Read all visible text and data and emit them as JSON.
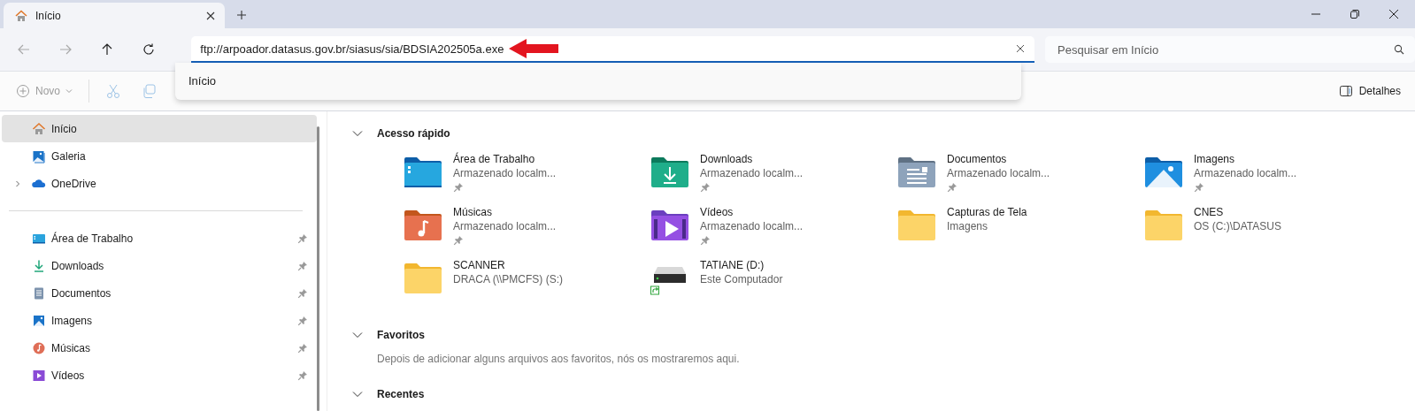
{
  "tab": {
    "title": "Início",
    "selected": true
  },
  "nav_buttons": [
    {
      "kind": "back",
      "disabled": true
    },
    {
      "kind": "forward",
      "disabled": true
    },
    {
      "kind": "up",
      "disabled": false
    },
    {
      "kind": "refresh",
      "disabled": false
    }
  ],
  "address": {
    "value": "ftp://arpoador.datasus.gov.br/siasus/sia/BDSIA202505a.exe",
    "suggestions": [
      {
        "label": "Início",
        "selected": false
      }
    ]
  },
  "search": {
    "placeholder": "Pesquisar em Início"
  },
  "toolbar": {
    "new_button": {
      "label": "Novo",
      "disabled": true
    },
    "actions": [
      {
        "kind": "cut",
        "disabled": true
      },
      {
        "kind": "copy",
        "disabled": true
      }
    ],
    "details_button": {
      "label": "Detalhes"
    }
  },
  "sidebar": {
    "items": [
      {
        "label": "Início",
        "kind": "home",
        "selected": true,
        "pinned": false,
        "expandable": false
      },
      {
        "label": "Galeria",
        "kind": "gallery",
        "selected": false,
        "pinned": false,
        "expandable": false
      },
      {
        "label": "OneDrive",
        "kind": "cloud",
        "selected": false,
        "pinned": false,
        "expandable": true
      }
    ],
    "pinned_items": [
      {
        "label": "Área de Trabalho",
        "kind": "desktop",
        "selected": false,
        "pinned": true
      },
      {
        "label": "Downloads",
        "kind": "downloads",
        "selected": false,
        "pinned": true
      },
      {
        "label": "Documentos",
        "kind": "documents",
        "selected": false,
        "pinned": true
      },
      {
        "label": "Imagens",
        "kind": "images",
        "selected": false,
        "pinned": true
      },
      {
        "label": "Músicas",
        "kind": "music",
        "selected": false,
        "pinned": true
      },
      {
        "label": "Vídeos",
        "kind": "videos",
        "selected": false,
        "pinned": true
      }
    ]
  },
  "sections": [
    {
      "title": "Acesso rápido",
      "expanded": true,
      "items": [
        {
          "name": "Área de Trabalho",
          "detail": "Armazenado localm...",
          "kind": "desktop",
          "pinned": true
        },
        {
          "name": "Downloads",
          "detail": "Armazenado localm...",
          "kind": "downloads",
          "pinned": true
        },
        {
          "name": "Documentos",
          "detail": "Armazenado localm...",
          "kind": "documents",
          "pinned": true
        },
        {
          "name": "Imagens",
          "detail": "Armazenado localm...",
          "kind": "images",
          "pinned": true
        },
        {
          "name": "Músicas",
          "detail": "Armazenado localm...",
          "kind": "music",
          "pinned": true
        },
        {
          "name": "Vídeos",
          "detail": "Armazenado localm...",
          "kind": "videos",
          "pinned": true
        },
        {
          "name": "Capturas de Tela",
          "detail": "Imagens",
          "kind": "folder",
          "pinned": false
        },
        {
          "name": "CNES",
          "detail": "OS (C:)\\DATASUS",
          "kind": "folder",
          "pinned": false
        },
        {
          "name": "SCANNER",
          "detail": "DRACA (\\\\PMCFS) (S:)",
          "kind": "folder",
          "pinned": false
        },
        {
          "name": "TATIANE (D:)",
          "detail": "Este Computador",
          "kind": "drive",
          "pinned": false
        }
      ]
    },
    {
      "title": "Favoritos",
      "expanded": true,
      "message": "Depois de adicionar alguns arquivos aos favoritos, nós os mostraremos aqui."
    },
    {
      "title": "Recentes",
      "expanded": true
    }
  ]
}
